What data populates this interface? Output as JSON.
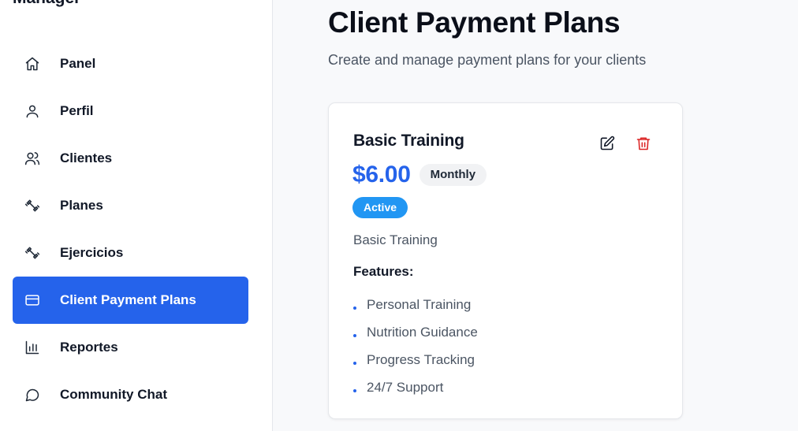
{
  "app": {
    "brand": "Manager"
  },
  "sidebar": {
    "items": [
      {
        "label": "Panel",
        "icon": "home-icon",
        "active": false
      },
      {
        "label": "Perfil",
        "icon": "user-icon",
        "active": false
      },
      {
        "label": "Clientes",
        "icon": "users-icon",
        "active": false
      },
      {
        "label": "Planes",
        "icon": "dumbbell-icon",
        "active": false
      },
      {
        "label": "Ejercicios",
        "icon": "dumbbell-icon",
        "active": false
      },
      {
        "label": "Client Payment Plans",
        "icon": "credit-card-icon",
        "active": true
      },
      {
        "label": "Reportes",
        "icon": "bar-chart-icon",
        "active": false
      },
      {
        "label": "Community Chat",
        "icon": "message-circle-icon",
        "active": false
      }
    ]
  },
  "main": {
    "title": "Client Payment Plans",
    "subtitle": "Create and manage payment plans for your clients"
  },
  "plan": {
    "name": "Basic Training",
    "price": "$6.00",
    "frequency": "Monthly",
    "status": "Active",
    "description": "Basic Training",
    "features_title": "Features:",
    "features": [
      "Personal Training",
      "Nutrition Guidance",
      "Progress Tracking",
      "24/7 Support"
    ],
    "actions": {
      "edit_icon": "edit-icon",
      "delete_icon": "trash-icon"
    }
  },
  "colors": {
    "accent": "#2563eb",
    "status_badge": "#2196f3",
    "danger": "#dc2626"
  }
}
